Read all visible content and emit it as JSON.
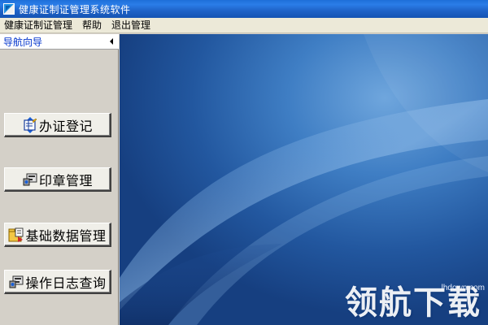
{
  "window": {
    "title": "健康证制证管理系统软件",
    "icon": "app-logo-icon"
  },
  "menubar": {
    "items": [
      "健康证制证管理",
      "帮助",
      "退出管理"
    ]
  },
  "nav": {
    "title": "导航向导",
    "collapse_icon": "chevron-left-icon",
    "buttons": [
      {
        "label": "办证登记",
        "icon": "register-card-icon"
      },
      {
        "label": "印章管理",
        "icon": "seal-icon"
      },
      {
        "label": "基础数据管理",
        "icon": "data-folder-icon"
      },
      {
        "label": "操作日志查询",
        "icon": "log-query-icon"
      }
    ]
  },
  "watermark": {
    "url": "lhdown.com",
    "text": "领航下载"
  },
  "colors": {
    "titlebar": "#1f63c8",
    "menubar": "#ece9d8",
    "panel": "#d4d0c8",
    "nav_title": "#0033cc",
    "desktop": "#1c4f9c"
  }
}
